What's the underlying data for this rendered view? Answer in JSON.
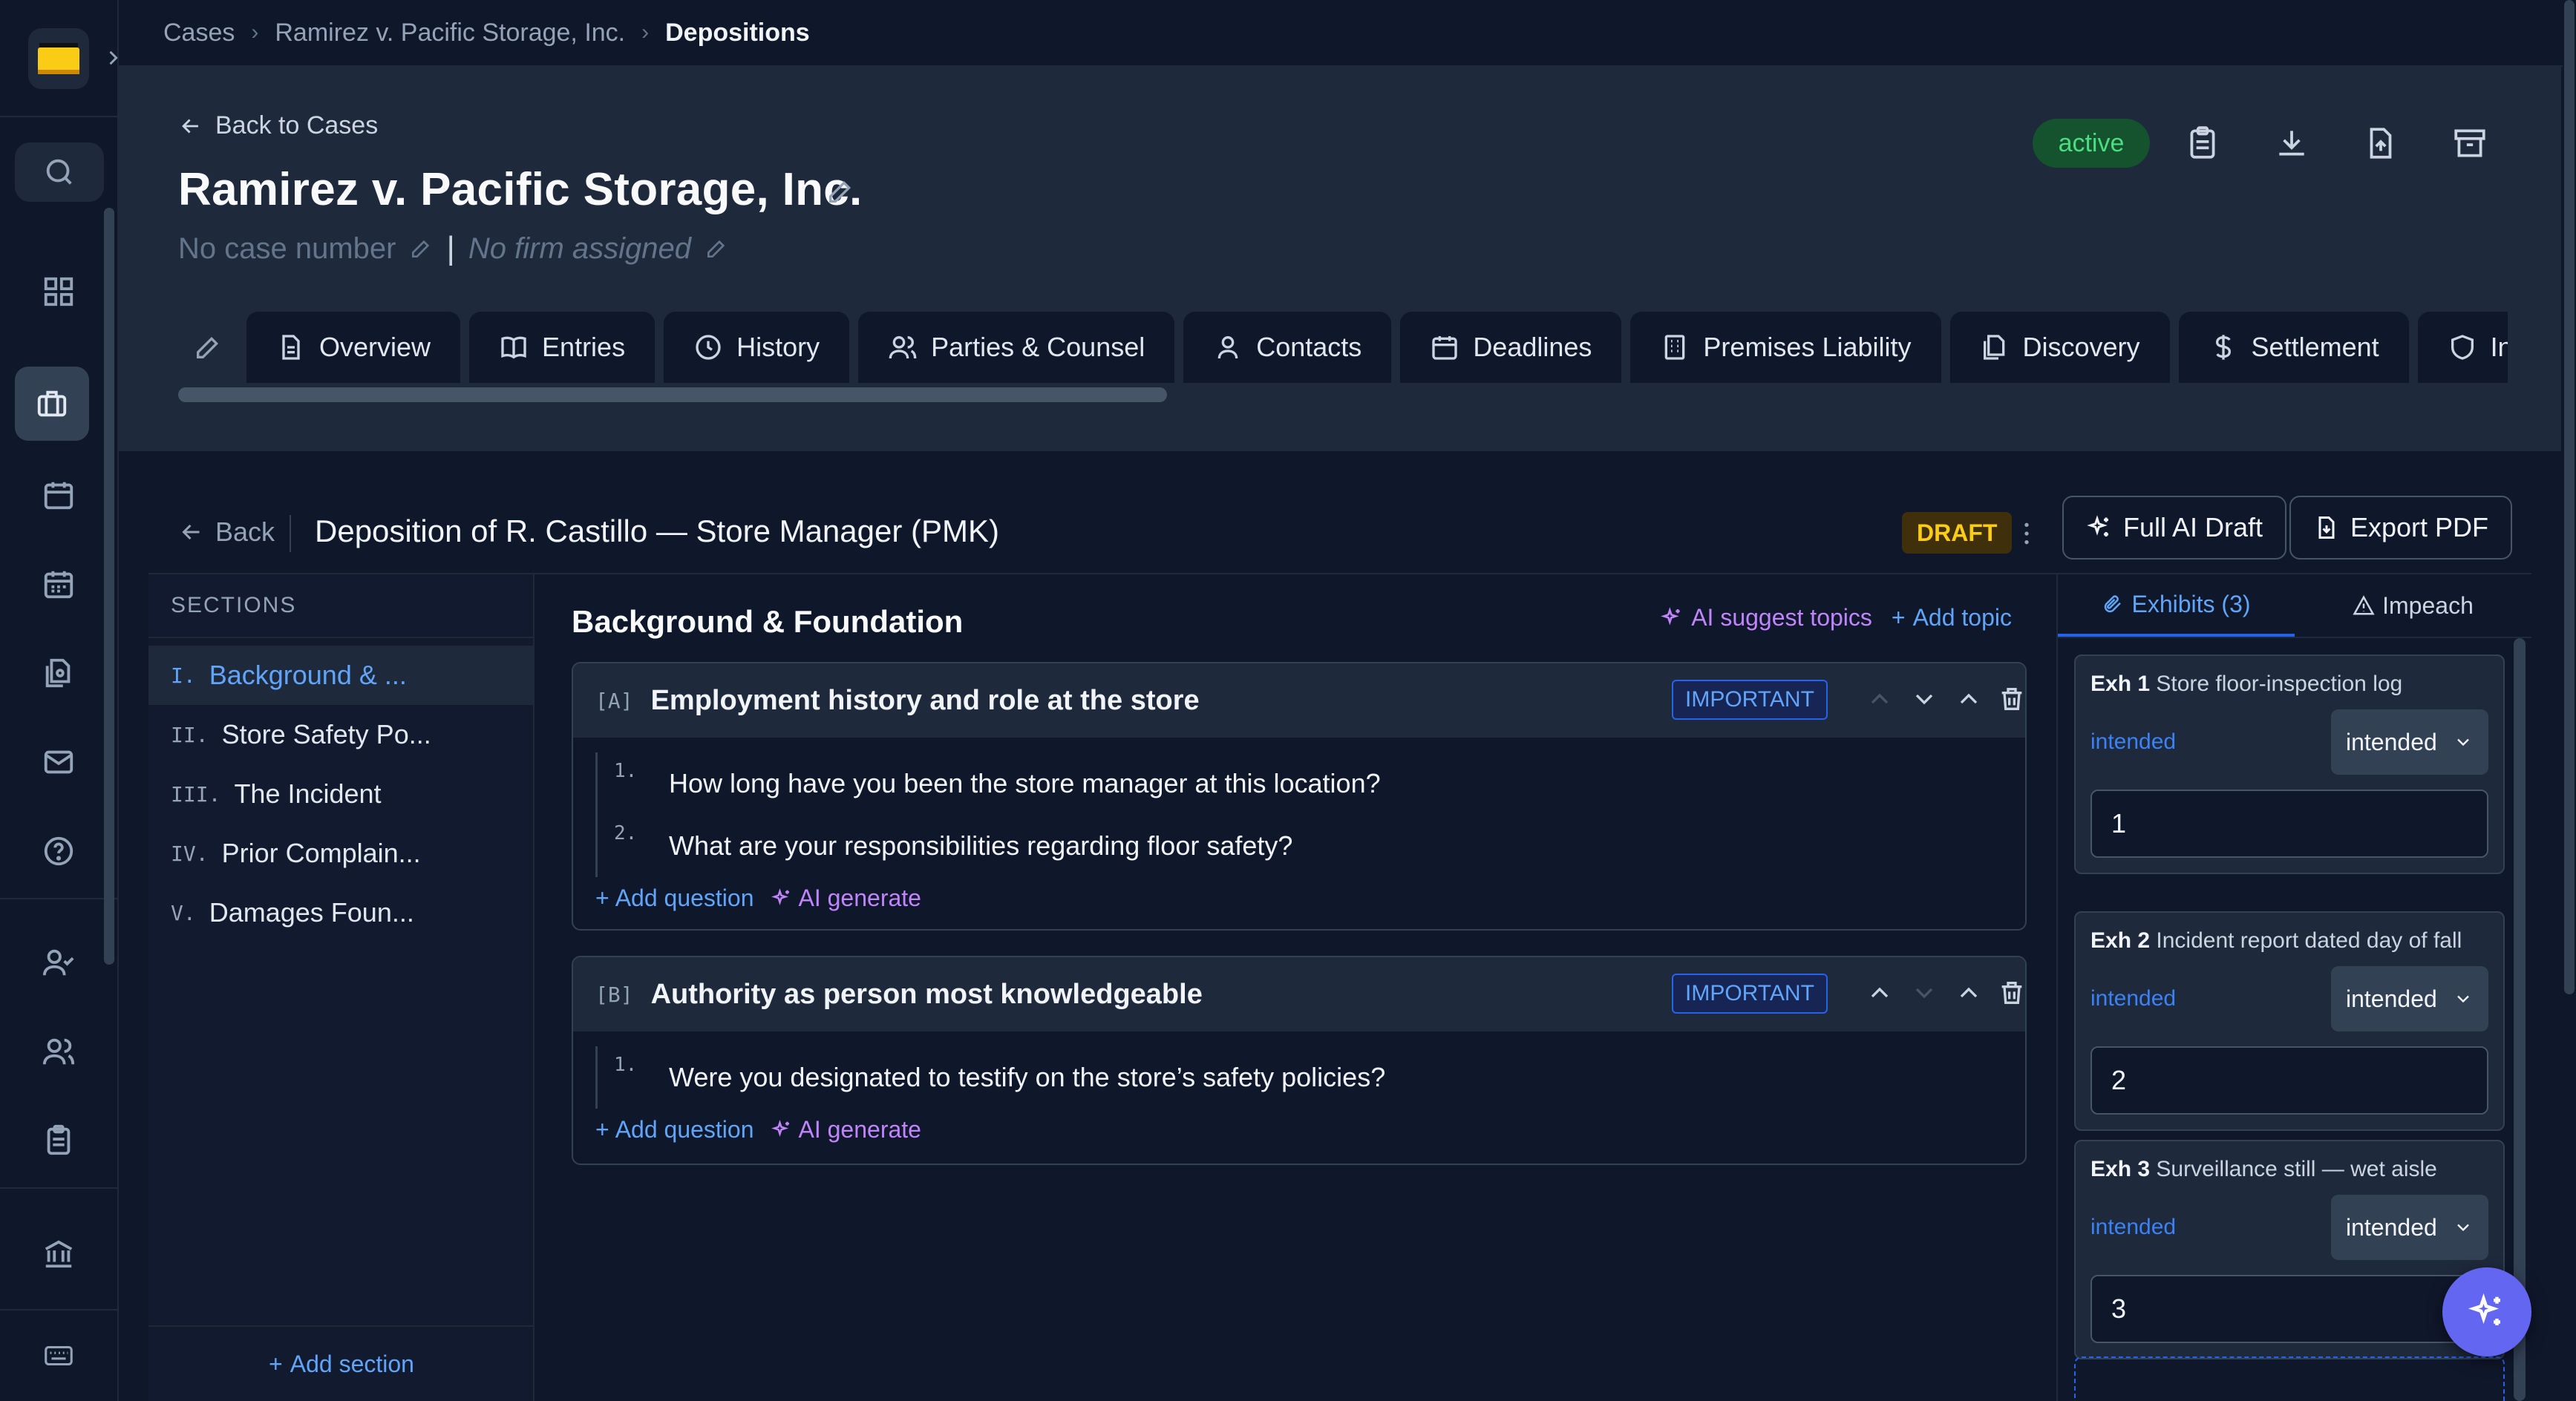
{
  "breadcrumb": {
    "root": "Cases",
    "case": "Ramirez v. Pacific Storage, Inc.",
    "current": "Depositions"
  },
  "case": {
    "back_label": "Back to Cases",
    "title": "Ramirez v. Pacific Storage, Inc.",
    "case_number": "No case number",
    "firm": "No firm assigned",
    "status": "active"
  },
  "tabs": [
    {
      "label": "Overview",
      "icon": "document-icon"
    },
    {
      "label": "Entries",
      "icon": "book-icon"
    },
    {
      "label": "History",
      "icon": "clock-icon"
    },
    {
      "label": "Parties & Counsel",
      "icon": "users-icon"
    },
    {
      "label": "Contacts",
      "icon": "user-icon"
    },
    {
      "label": "Deadlines",
      "icon": "calendar-icon"
    },
    {
      "label": "Premises Liability",
      "icon": "building-icon"
    },
    {
      "label": "Discovery",
      "icon": "files-icon"
    },
    {
      "label": "Settlement",
      "icon": "dollar-icon"
    },
    {
      "label": "Ins",
      "icon": "shield-icon"
    }
  ],
  "deposition": {
    "back_label": "Back",
    "title": "Deposition of R. Castillo — Store Manager (PMK)",
    "badge": "DRAFT",
    "full_ai_draft": "Full AI Draft",
    "export_pdf": "Export PDF"
  },
  "sections": {
    "heading": "SECTIONS",
    "items": [
      {
        "num": "I.",
        "label": "Background & ..."
      },
      {
        "num": "II.",
        "label": "Store Safety Po..."
      },
      {
        "num": "III.",
        "label": "The Incident"
      },
      {
        "num": "IV.",
        "label": "Prior Complain..."
      },
      {
        "num": "V.",
        "label": "Damages Foun..."
      }
    ],
    "add_label": "Add section"
  },
  "main": {
    "heading": "Background & Foundation",
    "ai_suggest": "AI suggest topics",
    "add_topic": "Add topic",
    "topics": [
      {
        "letter": "[A]",
        "title": "Employment history and role at the store",
        "priority": "IMPORTANT",
        "questions": [
          {
            "num": "1.",
            "text": "How long have you been the store manager at this location?"
          },
          {
            "num": "2.",
            "text": "What are your responsibilities regarding floor safety?"
          }
        ],
        "add_question": "Add question",
        "ai_generate": "AI generate"
      },
      {
        "letter": "[B]",
        "title": "Authority as person most knowledgeable",
        "priority": "IMPORTANT",
        "questions": [
          {
            "num": "1.",
            "text": "Were you designated to testify on the store’s safety policies?"
          }
        ],
        "add_question": "Add question",
        "ai_generate": "AI generate"
      }
    ]
  },
  "exhibits": {
    "tab_exhibits": "Exhibits (3)",
    "tab_impeach": "Impeach",
    "items": [
      {
        "label": "Exh 1",
        "desc": "Store floor-inspection log",
        "status": "intended",
        "select": "intended",
        "value": "1"
      },
      {
        "label": "Exh 2",
        "desc": "Incident report dated day of fall",
        "status": "intended",
        "select": "intended",
        "value": "2"
      },
      {
        "label": "Exh 3",
        "desc": "Surveillance still — wet aisle",
        "status": "intended",
        "select": "intended",
        "value": "3"
      }
    ]
  },
  "colors": {
    "accent": "#2563eb",
    "ai": "#c084fc",
    "status_active": "#4ade80",
    "draft": "#facc15",
    "background": "#0f172a"
  }
}
